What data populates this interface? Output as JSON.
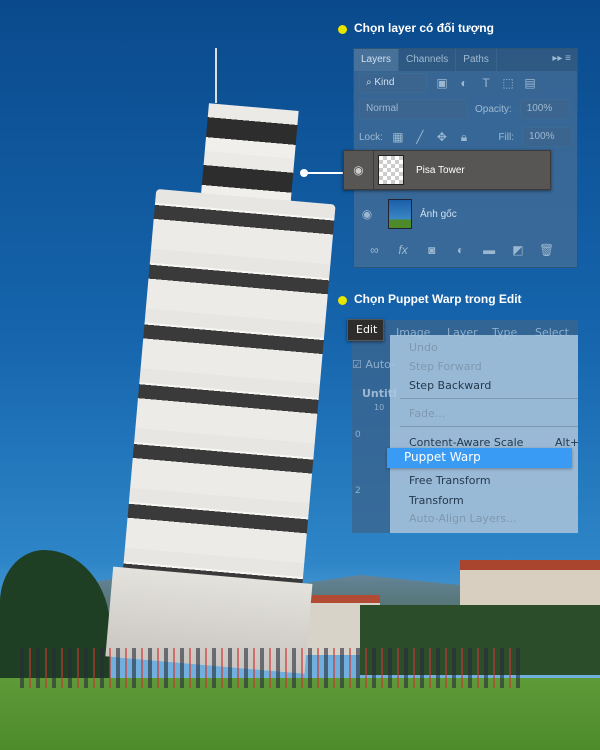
{
  "annotations": {
    "step1": "Chọn layer có đối tượng",
    "step2": "Chọn Puppet Warp trong Edit",
    "bullet_color": "#e6e600"
  },
  "layers_panel": {
    "tabs": [
      "Layers",
      "Channels",
      "Paths"
    ],
    "filter": "Kind",
    "blend_mode": "Normal",
    "opacity_label": "Opacity:",
    "opacity_value": "100%",
    "lock_label": "Lock:",
    "fill_label": "Fill:",
    "fill_value": "100%",
    "layers": [
      {
        "name": "Pisa Tower",
        "selected": true
      },
      {
        "name": "Ảnh gốc",
        "selected": false
      }
    ],
    "footer_icons": [
      "link-icon",
      "fx-icon",
      "mask-icon",
      "adjustment-icon",
      "folder-icon",
      "new-layer-icon",
      "trash-icon"
    ]
  },
  "edit_menu": {
    "menubar": [
      "Edit",
      "Image",
      "Layer",
      "Type",
      "Select"
    ],
    "options_label": "Auto-",
    "doc_tab": "Untitl",
    "ruler": [
      "10",
      "0",
      "2"
    ],
    "items": [
      {
        "label": "Undo",
        "enabled": false
      },
      {
        "label": "Step Forward",
        "enabled": false
      },
      {
        "label": "Step Backward",
        "enabled": true
      },
      {
        "label": "Fade...",
        "enabled": false
      },
      {
        "label": "Content-Aware Scale",
        "shortcut": "Alt+",
        "enabled": true
      },
      {
        "label": "Puppet Warp",
        "enabled": true,
        "highlighted": true
      },
      {
        "label": "Free Transform",
        "enabled": true
      },
      {
        "label": "Transform",
        "enabled": true
      },
      {
        "label": "Auto-Align Layers...",
        "enabled": false
      }
    ]
  }
}
